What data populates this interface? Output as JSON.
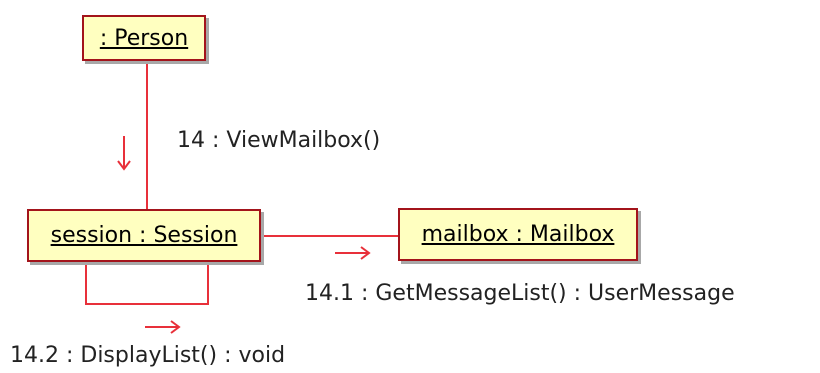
{
  "diagram": {
    "type": "UML communication diagram",
    "colors": {
      "object_fill": "#ffffc0",
      "object_border": "#a3141b",
      "link_line": "#e8303a",
      "text": "#000000"
    },
    "objects": [
      {
        "id": "person",
        "label": " : Person"
      },
      {
        "id": "session",
        "label": "session : Session"
      },
      {
        "id": "mailbox",
        "label": "mailbox : Mailbox"
      }
    ],
    "messages": [
      {
        "id": "m14",
        "label": "14 : ViewMailbox()",
        "from": "person",
        "to": "session",
        "arrow": "down"
      },
      {
        "id": "m14_1",
        "label": "14.1 : GetMessageList() : UserMessage",
        "from": "session",
        "to": "mailbox",
        "arrow": "right"
      },
      {
        "id": "m14_2",
        "label": "14.2 : DisplayList() : void",
        "from": "session",
        "to": "session",
        "arrow": "right"
      }
    ]
  }
}
